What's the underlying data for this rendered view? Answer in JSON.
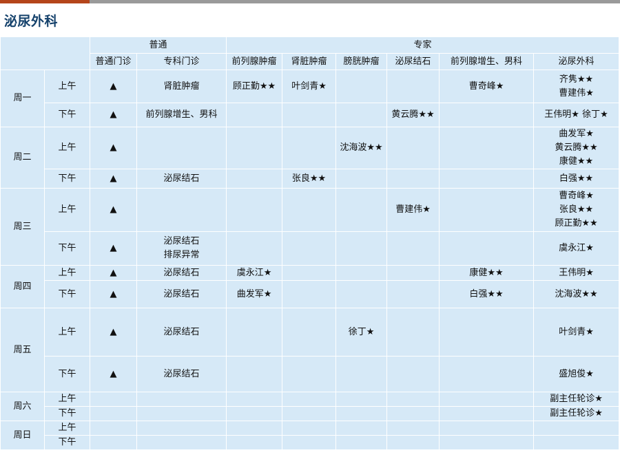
{
  "title": "泌尿外科",
  "header": {
    "general": "普通",
    "expert": "专家",
    "cols": [
      "普通门诊",
      "专科门诊",
      "前列腺肿瘤",
      "肾脏肿瘤",
      "膀胱肿瘤",
      "泌尿结石",
      "前列腺增生、男科",
      "泌尿外科"
    ]
  },
  "days": [
    {
      "day": "周一",
      "slots": [
        {
          "period": "上午",
          "cells": [
            "▲",
            "肾脏肿瘤",
            "顾正勤★★",
            "叶剑青★",
            "",
            "",
            "曹奇峰★",
            [
              "齐隽★★",
              "曹建伟★"
            ]
          ]
        },
        {
          "period": "下午",
          "cells": [
            "▲",
            "前列腺增生、男科",
            "",
            "",
            "",
            "黄云腾★★",
            "",
            "王伟明★  徐丁★"
          ]
        }
      ]
    },
    {
      "day": "周二",
      "slots": [
        {
          "period": "上午",
          "cells": [
            "▲",
            "",
            "",
            "",
            "沈海波★★",
            "",
            "",
            [
              "曲发军★",
              "黄云腾★★",
              "康健★★"
            ]
          ]
        },
        {
          "period": "下午",
          "cells": [
            "▲",
            "泌尿结石",
            "",
            "张良★★",
            "",
            "",
            "",
            "白强★★"
          ]
        }
      ]
    },
    {
      "day": "周三",
      "slots": [
        {
          "period": "上午",
          "cells": [
            "▲",
            "",
            "",
            "",
            "",
            "曹建伟★",
            "",
            [
              "曹奇峰★",
              "张良★★",
              "顾正勤★★"
            ]
          ]
        },
        {
          "period": "下午",
          "cells": [
            "▲",
            [
              "泌尿结石",
              "排尿异常"
            ],
            "",
            "",
            "",
            "",
            "",
            "虞永江★"
          ]
        }
      ]
    },
    {
      "day": "周四",
      "slots": [
        {
          "period": "上午",
          "cells": [
            "▲",
            "泌尿结石",
            "虞永江★",
            "",
            "",
            "",
            "康健★★",
            "王伟明★"
          ]
        },
        {
          "period": "下午",
          "cells": [
            "▲",
            "泌尿结石",
            "曲发军★",
            "",
            "",
            "",
            "白强★★",
            "沈海波★★"
          ]
        }
      ]
    },
    {
      "day": "周五",
      "slots": [
        {
          "period": "上午",
          "cells": [
            "▲",
            "泌尿结石",
            "",
            "",
            "徐丁★",
            "",
            "",
            "叶剑青★"
          ]
        },
        {
          "period": "下午",
          "cells": [
            "▲",
            "泌尿结石",
            "",
            "",
            "",
            "",
            "",
            "盛旭俊★"
          ]
        }
      ]
    },
    {
      "day": "周六",
      "slots": [
        {
          "period": "上午",
          "cells": [
            "",
            "",
            "",
            "",
            "",
            "",
            "",
            "副主任轮诊★"
          ]
        },
        {
          "period": "下午",
          "cells": [
            "",
            "",
            "",
            "",
            "",
            "",
            "",
            "副主任轮诊★"
          ]
        }
      ]
    },
    {
      "day": "周日",
      "slots": [
        {
          "period": "上午",
          "cells": [
            "",
            "",
            "",
            "",
            "",
            "",
            "",
            ""
          ]
        },
        {
          "period": "下午",
          "cells": [
            "",
            "",
            "",
            "",
            "",
            "",
            "",
            ""
          ]
        }
      ]
    }
  ]
}
